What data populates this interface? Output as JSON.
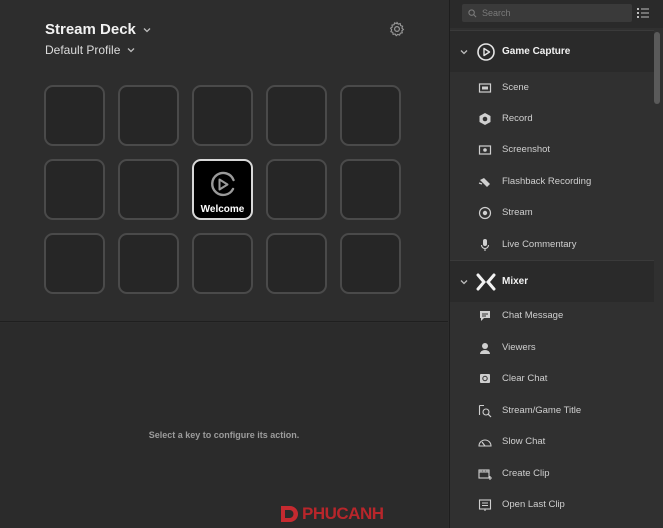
{
  "device": {
    "name": "Stream Deck",
    "profile": "Default Profile"
  },
  "keys": {
    "welcome_label": "Welcome"
  },
  "hint": "Select a key to configure its action.",
  "watermark": {
    "brand": "PHUCANH"
  },
  "sidebar": {
    "search_placeholder": "Search",
    "sections": [
      {
        "label": "Game Capture",
        "items": [
          "Scene",
          "Record",
          "Screenshot",
          "Flashback Recording",
          "Stream",
          "Live Commentary"
        ]
      },
      {
        "label": "Mixer",
        "items": [
          "Chat Message",
          "Viewers",
          "Clear Chat",
          "Stream/Game Title",
          "Slow Chat",
          "Create Clip",
          "Open Last Clip"
        ]
      }
    ]
  }
}
